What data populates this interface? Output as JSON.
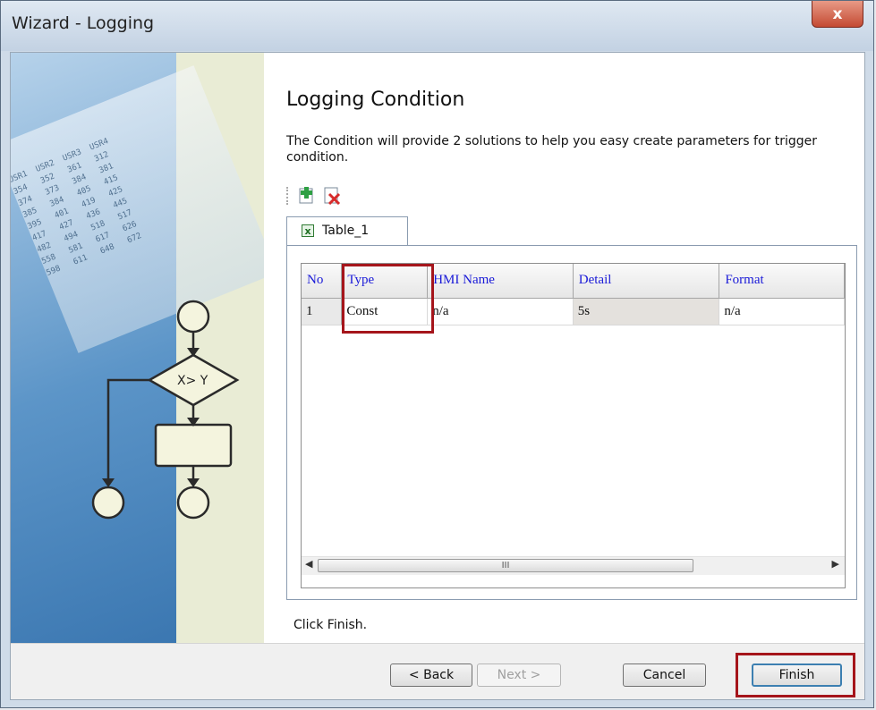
{
  "window": {
    "title": "Wizard - Logging",
    "close_label": "x"
  },
  "page": {
    "heading": "Logging Condition",
    "description": "The Condition will provide 2 solutions to  help you easy create parameters for trigger condition.",
    "hint": "Click Finish."
  },
  "illustration": {
    "condition_label": "X> Y"
  },
  "toolbar": {
    "add_icon": "add-table-icon",
    "delete_icon": "delete-table-icon"
  },
  "tabs": [
    {
      "label": "Table_1",
      "icon": "excel-icon"
    }
  ],
  "grid": {
    "columns": [
      "No",
      "Type",
      "HMI Name",
      "Detail",
      "Format"
    ],
    "rows": [
      [
        "1",
        "Const",
        "n/a",
        "5s",
        "n/a"
      ]
    ],
    "scroll_thumb_label": "III"
  },
  "buttons": {
    "back": "< Back",
    "next": "Next >",
    "cancel": "Cancel",
    "finish": "Finish"
  },
  "colors": {
    "highlight": "#a5151b",
    "header_text": "#1a1ad8"
  }
}
